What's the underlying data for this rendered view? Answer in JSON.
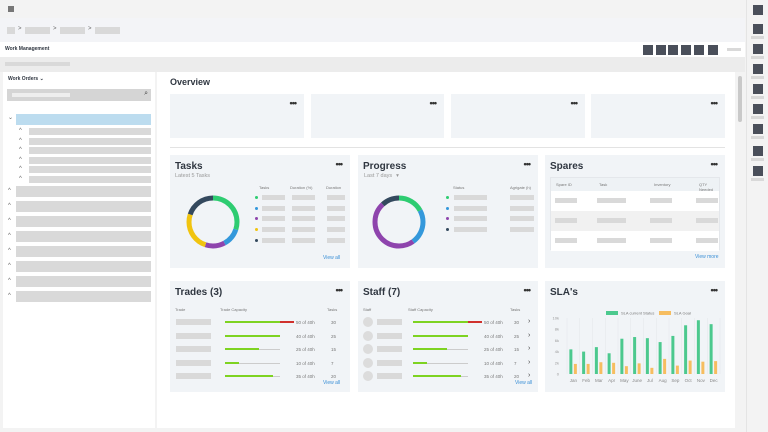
{
  "header": {
    "title": "Work Management"
  },
  "sidebar": {
    "title": "Work Orders"
  },
  "main": {
    "title": "Overview"
  },
  "tasks": {
    "title": "Tasks",
    "subtitle": "Latest 5 Tasks",
    "cols": [
      "Tasks",
      "Duration (%)",
      "Duration"
    ],
    "view_all": "View all",
    "segments": [
      {
        "color": "#2ecc71",
        "value": 30
      },
      {
        "color": "#3498db",
        "value": 12
      },
      {
        "color": "#8e44ad",
        "value": 13
      },
      {
        "color": "#f1c40f",
        "value": 25
      },
      {
        "color": "#34495e",
        "value": 20
      }
    ]
  },
  "progress": {
    "title": "Progress",
    "filter": "Last 7 days",
    "cols": [
      "Status",
      "Agrigate (h)"
    ],
    "segments": [
      {
        "color": "#2ecc71",
        "value": 17
      },
      {
        "color": "#3498db",
        "value": 23
      },
      {
        "color": "#8e44ad",
        "value": 48
      },
      {
        "color": "#34495e",
        "value": 12
      }
    ]
  },
  "spares": {
    "title": "Spares",
    "cols": [
      "Spare ID",
      "Task",
      "Inventory",
      "QTY Needed"
    ],
    "view_more": "View more"
  },
  "trades": {
    "title": "Trades (3)",
    "cols": [
      "Trade",
      "Trade Capacity",
      "Tasks"
    ],
    "view_all": "View all",
    "rows": [
      {
        "hours": 50,
        "label": "50 of 40h",
        "tasks": "30"
      },
      {
        "hours": 40,
        "label": "40 of 40h",
        "tasks": "25"
      },
      {
        "hours": 25,
        "label": "25 of 40h",
        "tasks": "15"
      },
      {
        "hours": 10,
        "label": "10 of 40h",
        "tasks": "7"
      },
      {
        "hours": 35,
        "label": "35 of 40h",
        "tasks": "20"
      }
    ]
  },
  "staff": {
    "title": "Staff  (7)",
    "cols": [
      "Staff",
      "Staff Capacity",
      "Tasks"
    ],
    "view_all": "View all",
    "rows": [
      {
        "hours": 50,
        "label": "50 of 40h",
        "tasks": "30"
      },
      {
        "hours": 40,
        "label": "40 of 40h",
        "tasks": "25"
      },
      {
        "hours": 25,
        "label": "25 of 40h",
        "tasks": "15"
      },
      {
        "hours": 10,
        "label": "10 of 40h",
        "tasks": "7"
      },
      {
        "hours": 35,
        "label": "35 of 40h",
        "tasks": "20"
      }
    ]
  },
  "colors": {
    "over": "#d0312d",
    "fill": "#7ed321",
    "current": "#4cc98e",
    "goal": "#f6bd60"
  },
  "chart_data": {
    "type": "bar",
    "title": "SLA's",
    "categories": [
      "Jan",
      "Feb",
      "Mar",
      "Apr",
      "May",
      "June",
      "Jul",
      "Aug",
      "Sep",
      "Oct",
      "Nov",
      "Dec"
    ],
    "series": [
      {
        "name": "SLA current Status",
        "values": [
          4.4,
          4.0,
          4.8,
          3.7,
          6.3,
          6.6,
          6.4,
          5.7,
          6.8,
          8.7,
          9.6,
          8.9
        ]
      },
      {
        "name": "SLA Goal",
        "values": [
          1.8,
          1.8,
          2.1,
          2.0,
          1.4,
          1.9,
          1.1,
          2.7,
          1.5,
          2.4,
          2.2,
          2.3
        ]
      }
    ],
    "yticks": [
      "0",
      "2k",
      "4k",
      "6k",
      "8k",
      "10k"
    ],
    "ylim": [
      0,
      10
    ],
    "legend": "top",
    "grid": "vertical"
  }
}
